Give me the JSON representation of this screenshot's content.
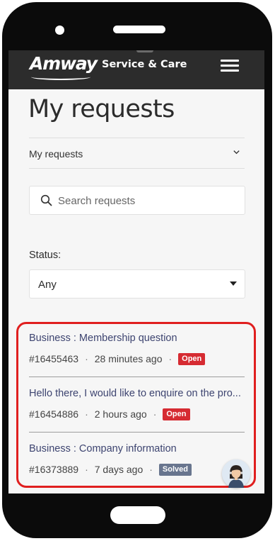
{
  "header": {
    "logo_text": "Amway",
    "service_text": "Service & Care"
  },
  "page": {
    "title": "My requests"
  },
  "filter": {
    "label": "My requests",
    "chevron": "⌄"
  },
  "search": {
    "placeholder": "Search requests",
    "value": ""
  },
  "status": {
    "label": "Status:",
    "selected": "Any"
  },
  "requests": [
    {
      "title": "Business : Membership question",
      "id": "#16455463",
      "time": "28 minutes ago",
      "badge": "Open"
    },
    {
      "title": "Hello there, I would like to enquire on the pro...",
      "id": "#16454886",
      "time": "2 hours ago",
      "badge": "Open"
    },
    {
      "title": "Business : Company information",
      "id": "#16373889",
      "time": "7 days ago",
      "badge": "Solved"
    }
  ],
  "separator": "·",
  "colors": {
    "header_bg": "#2c2c2c",
    "link": "#3d4470",
    "open_badge": "#d62b32",
    "solved_badge": "#68758e",
    "highlight": "#e01f1f"
  },
  "icons": [
    "menu-icon",
    "search-icon",
    "chevron-down-icon",
    "caret-down-icon",
    "chat-assistant-icon"
  ]
}
